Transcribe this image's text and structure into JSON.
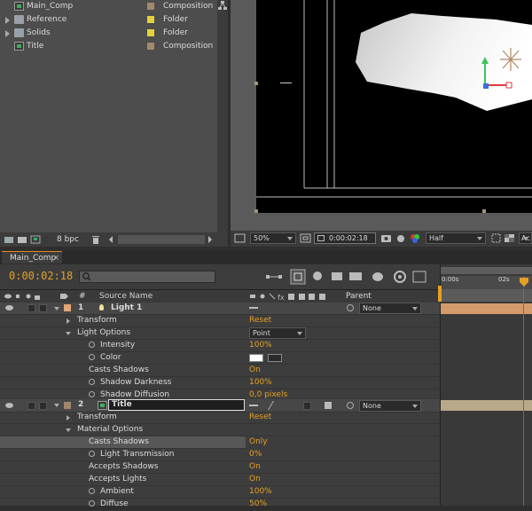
{
  "project": {
    "items": [
      {
        "name": "Main_Comp",
        "type": "Composition",
        "icon": "composition-icon",
        "color": "#a0896b",
        "folder": false
      },
      {
        "name": "Reference",
        "type": "Folder",
        "icon": "folder-icon",
        "color": "#e3d13a",
        "folder": true
      },
      {
        "name": "Solids",
        "type": "Folder",
        "icon": "folder-icon",
        "color": "#e3d13a",
        "folder": true
      },
      {
        "name": "Title",
        "type": "Composition",
        "icon": "composition-icon",
        "color": "#a0896b",
        "folder": false
      }
    ],
    "bpc": "8 bpc"
  },
  "viewer": {
    "zoom": "50%",
    "timecode": "0:00:02:18",
    "resolution": "Half",
    "extra": "Ac"
  },
  "timeline": {
    "tab": "Main_Comp",
    "timecode": "0:00:02:18",
    "search_placeholder": "",
    "columns": {
      "number": "#",
      "source": "Source Name",
      "parent": "Parent"
    },
    "ruler": {
      "start": "0:00s",
      "mark": "02s"
    },
    "layer1": {
      "index": "1",
      "name": "Light 1",
      "parent": "None",
      "color": "#e3a679"
    },
    "layer2": {
      "index": "2",
      "name": "Title",
      "parent": "None",
      "color": "#a0896b"
    },
    "rows": {
      "transform1": "Transform",
      "reset1": "Reset",
      "light_options": "Light Options",
      "light_type": "Point",
      "intensity": "Intensity",
      "intensity_val": "100%",
      "color": "Color",
      "casts_shadows": "Casts Shadows",
      "casts_shadows_val": "On",
      "shadow_darkness": "Shadow Darkness",
      "shadow_darkness_val": "100%",
      "shadow_diffusion": "Shadow Diffusion",
      "shadow_diffusion_val": "0,0 pixels",
      "transform2": "Transform",
      "reset2": "Reset",
      "material_options": "Material Options",
      "casts_shadows2": "Casts Shadows",
      "casts_shadows2_val": "Only",
      "light_transmission": "Light Transmission",
      "light_transmission_val": "0%",
      "accepts_shadows": "Accepts Shadows",
      "accepts_shadows_val": "On",
      "accepts_lights": "Accepts Lights",
      "accepts_lights_val": "On",
      "ambient": "Ambient",
      "ambient_val": "100%",
      "diffuse": "Diffuse",
      "diffuse_val": "50%"
    }
  },
  "colors": {
    "accent": "#e5a024",
    "playhead": "#e03b3b"
  }
}
